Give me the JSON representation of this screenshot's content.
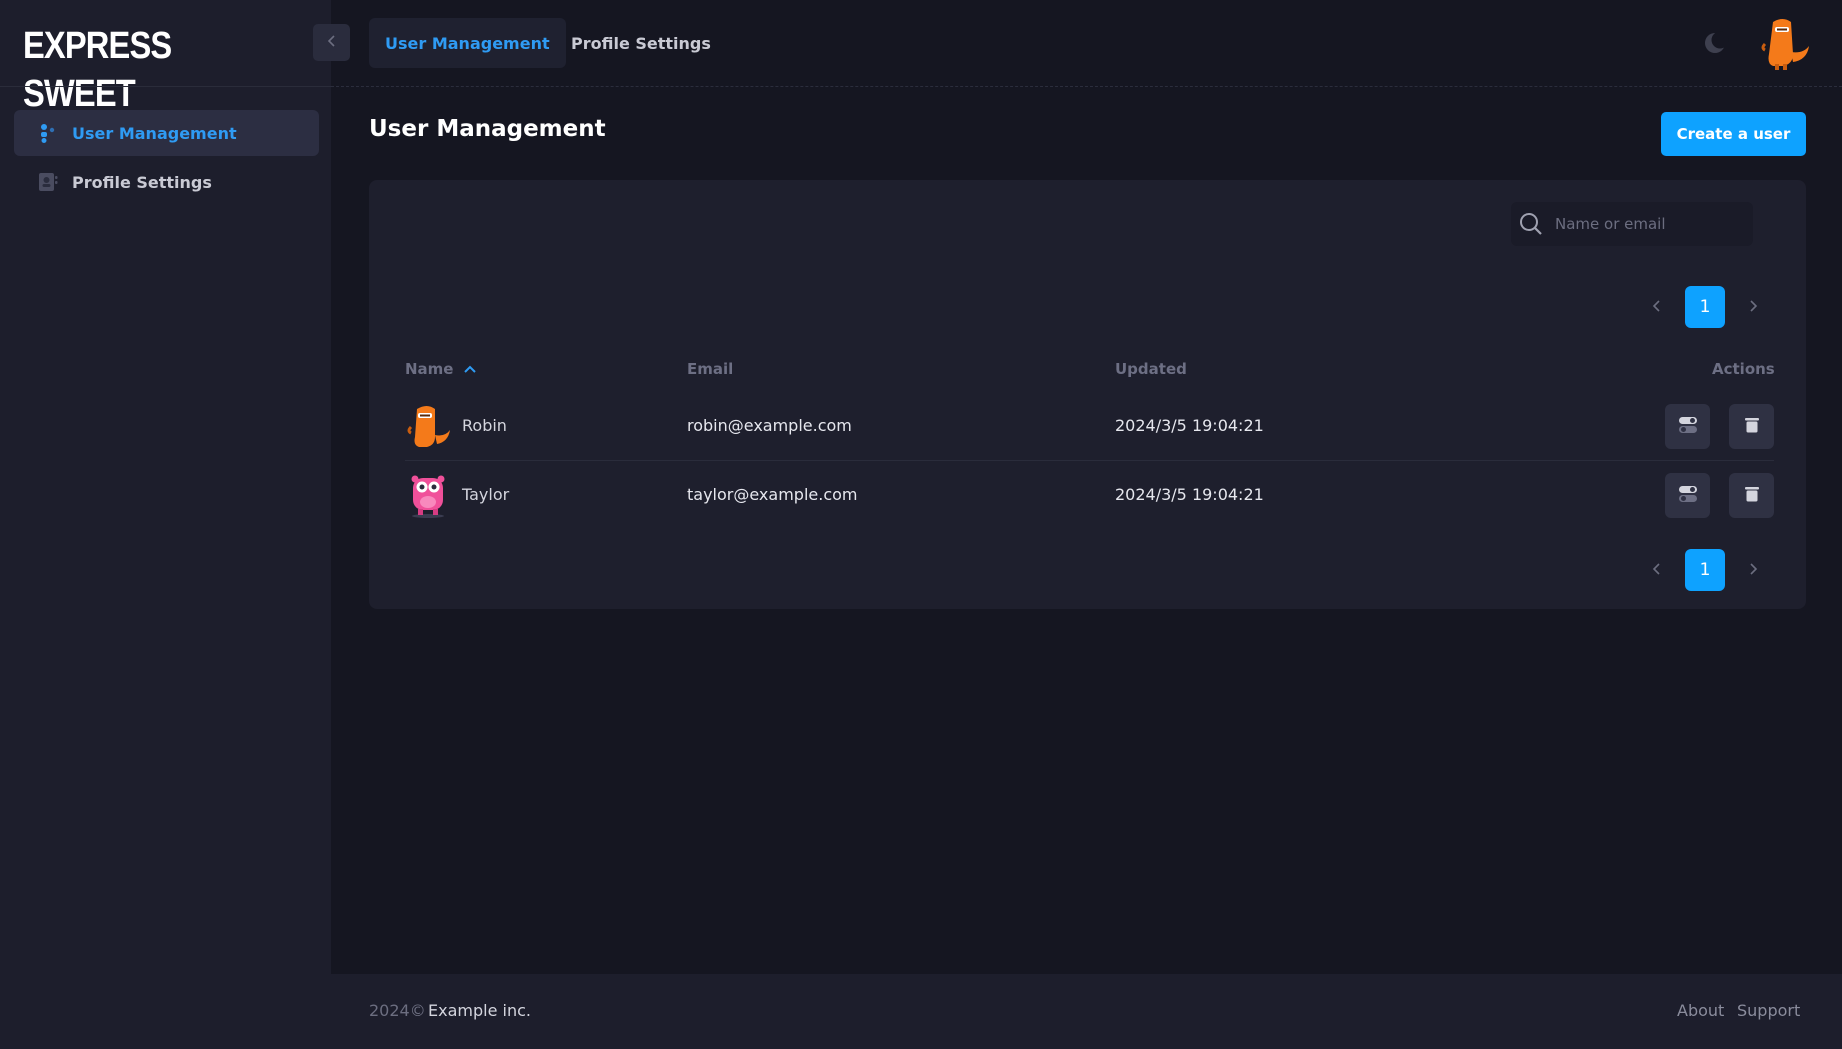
{
  "brand": "EXPRESS SWEET",
  "top_tabs": [
    {
      "label": "User Management"
    },
    {
      "label": "Profile Settings"
    }
  ],
  "sidebar": {
    "items": [
      {
        "label": "User Management",
        "icon": "users-icon"
      },
      {
        "label": "Profile Settings",
        "icon": "profile-card-icon"
      }
    ]
  },
  "page": {
    "title": "User Management",
    "create_label": "Create a user"
  },
  "search": {
    "placeholder": "Name or email",
    "value": ""
  },
  "pagination": {
    "current_page": "1"
  },
  "table": {
    "columns": {
      "name": "Name",
      "email": "Email",
      "updated": "Updated",
      "actions": "Actions"
    },
    "sort": {
      "column": "Name",
      "direction": "ascending"
    },
    "rows": [
      {
        "name": "Robin",
        "email": "robin@example.com",
        "updated": "2024/3/5 19:04:21",
        "avatar": "orange-dinosaur-avatar"
      },
      {
        "name": "Taylor",
        "email": "taylor@example.com",
        "updated": "2024/3/5 19:04:21",
        "avatar": "pink-monster-avatar"
      }
    ]
  },
  "footer": {
    "year": "2024©",
    "company": "Example inc.",
    "links": [
      "About",
      "Support"
    ]
  },
  "colors": {
    "accent": "#0ea2ff",
    "active_text": "#2f9bf3",
    "background": "#151621",
    "panel": "#1d1e2c",
    "card": "#1e1f2d"
  }
}
